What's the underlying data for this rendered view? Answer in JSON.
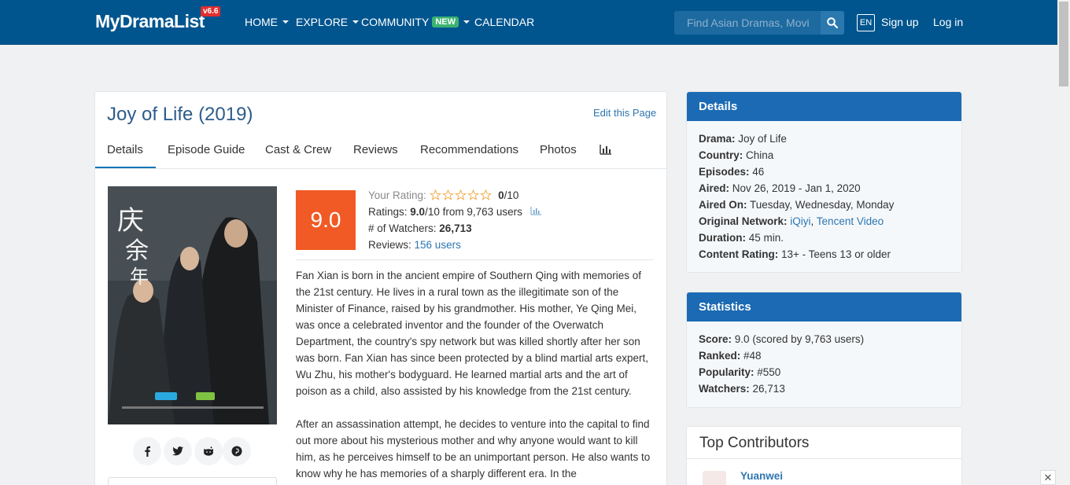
{
  "nav": {
    "logo": "MyDramaList",
    "version": "v6.6",
    "items": [
      {
        "label": "HOME",
        "caret": true
      },
      {
        "label": "EXPLORE",
        "caret": true
      },
      {
        "label": "COMMUNITY",
        "badge": "NEW",
        "caret": true
      },
      {
        "label": "CALENDAR",
        "caret": false
      }
    ],
    "search_placeholder": "Find Asian Dramas, Movi",
    "lang": "EN",
    "signup": "Sign up",
    "login": "Log in"
  },
  "page": {
    "title": "Joy of Life (2019)",
    "edit_link": "Edit this Page",
    "tabs": [
      "Details",
      "Episode Guide",
      "Cast & Crew",
      "Reviews",
      "Recommendations",
      "Photos"
    ],
    "active_tab": "Details"
  },
  "rating": {
    "score": "9.0",
    "your_rating_label": "Your Rating:",
    "your_rating_value": "0",
    "your_rating_suffix": "/10",
    "stars": 10,
    "ratings_label": "Ratings:",
    "ratings_value": "9.0",
    "ratings_from": "/10 from 9,763 users",
    "watchers_label": "# of Watchers:",
    "watchers_value": "26,713",
    "reviews_label": "Reviews:",
    "reviews_value": "156 users"
  },
  "synopsis": [
    "Fan Xian is born in the ancient empire of Southern Qing with memories of the 21st century. He lives in a rural town as the illegitimate son of the Minister of Finance, raised by his grandmother. His mother, Ye Qing Mei, was once a celebrated inventor and the founder of the Overwatch Department, the country's spy network but was killed shortly after her son was born. Fan Xian has since been protected by a blind martial arts expert, Wu Zhu, his mother's bodyguard. He learned martial arts and the art of poison as a child, also assisted by his knowledge from the 21st century.",
    "After an assassination attempt, he decides to venture into the capital to find out more about his mysterious mother and why anyone would want to kill him, as he perceives himself to be an unimportant person. He also wants to know why he has memories of a sharply different era. In the"
  ],
  "share_icons": [
    "facebook-icon",
    "twitter-icon",
    "reddit-icon",
    "pinterest-icon"
  ],
  "details": {
    "heading": "Details",
    "rows": [
      {
        "label": "Drama:",
        "value": "Joy of Life"
      },
      {
        "label": "Country:",
        "value": "China"
      },
      {
        "label": "Episodes:",
        "value": "46"
      },
      {
        "label": "Aired:",
        "value": "Nov 26, 2019 - Jan 1, 2020"
      },
      {
        "label": "Aired On:",
        "value": "Tuesday, Wednesday, Monday"
      },
      {
        "label": "Original Network:",
        "links": [
          "iQiyi",
          "Tencent Video"
        ]
      },
      {
        "label": "Duration:",
        "value": "45 min."
      },
      {
        "label": "Content Rating:",
        "value": "13+ - Teens 13 or older"
      }
    ]
  },
  "statistics": {
    "heading": "Statistics",
    "rows": [
      {
        "label": "Score:",
        "value": "9.0 (scored by 9,763 users)"
      },
      {
        "label": "Ranked:",
        "value": "#48"
      },
      {
        "label": "Popularity:",
        "value": "#550"
      },
      {
        "label": "Watchers:",
        "value": "26,713"
      }
    ]
  },
  "contributors": {
    "heading": "Top Contributors",
    "first": "Yuanwei"
  },
  "colors": {
    "navbar": "#00558f",
    "score": "#f15a24",
    "link": "#2d76b1",
    "side_head": "#1b6ab3"
  }
}
